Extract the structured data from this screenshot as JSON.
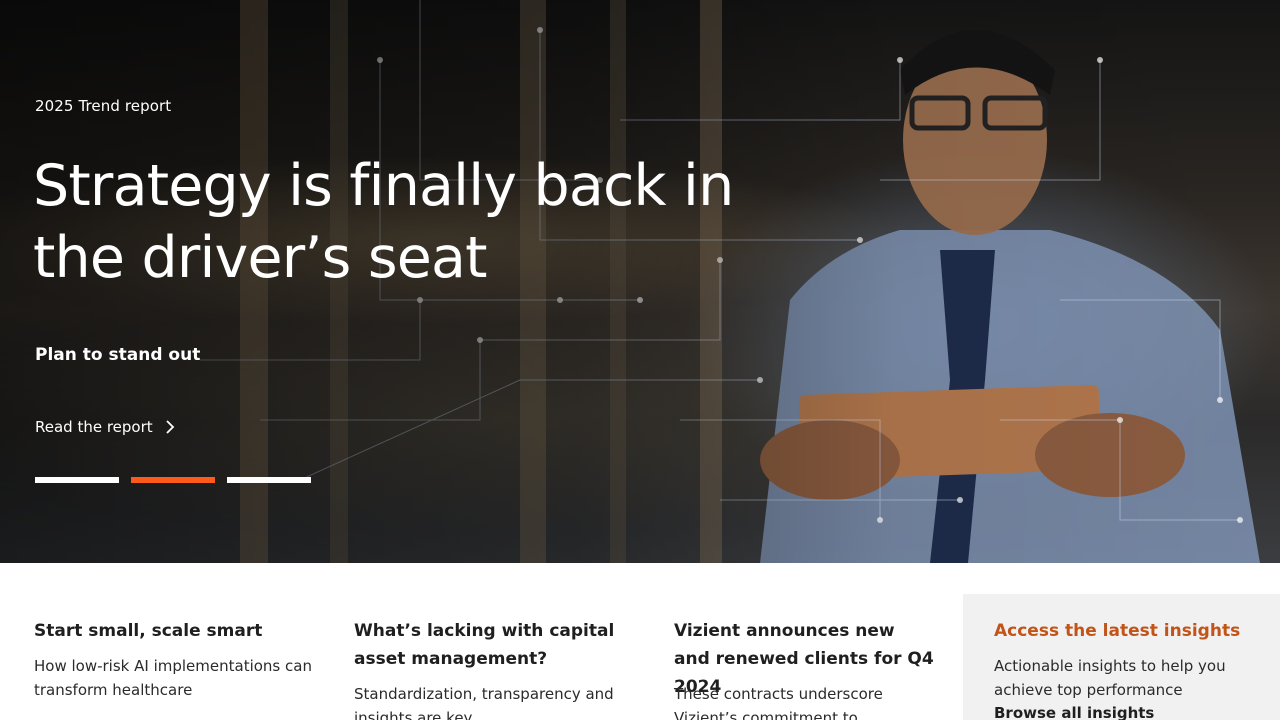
{
  "hero": {
    "eyebrow": "2025 Trend report",
    "title": "Strategy is finally back in the driver’s seat",
    "subtitle": "Plan to stand out",
    "cta_label": "Read the report",
    "carousel": {
      "slide_count": 3,
      "active_index": 1
    }
  },
  "colors": {
    "accent": "#ff5a1a",
    "highlight_title": "#c2541a",
    "card_highlight_bg": "#f1f1f1"
  },
  "cards": [
    {
      "title": "Start small, scale smart",
      "description": "How low-risk AI implementations can transform healthcare"
    },
    {
      "title": "What’s lacking with capital asset management?",
      "description": "Standardization, transparency and insights are key"
    },
    {
      "title": "Vizient announces new and renewed clients for Q4 2024",
      "description": "These contracts underscore Vizient’s commitment to"
    },
    {
      "title": "Access the latest insights",
      "description": "Actionable insights to help you achieve top performance",
      "link": "Browse all insights"
    }
  ],
  "icons": {
    "cta": "chevron-right-icon"
  }
}
